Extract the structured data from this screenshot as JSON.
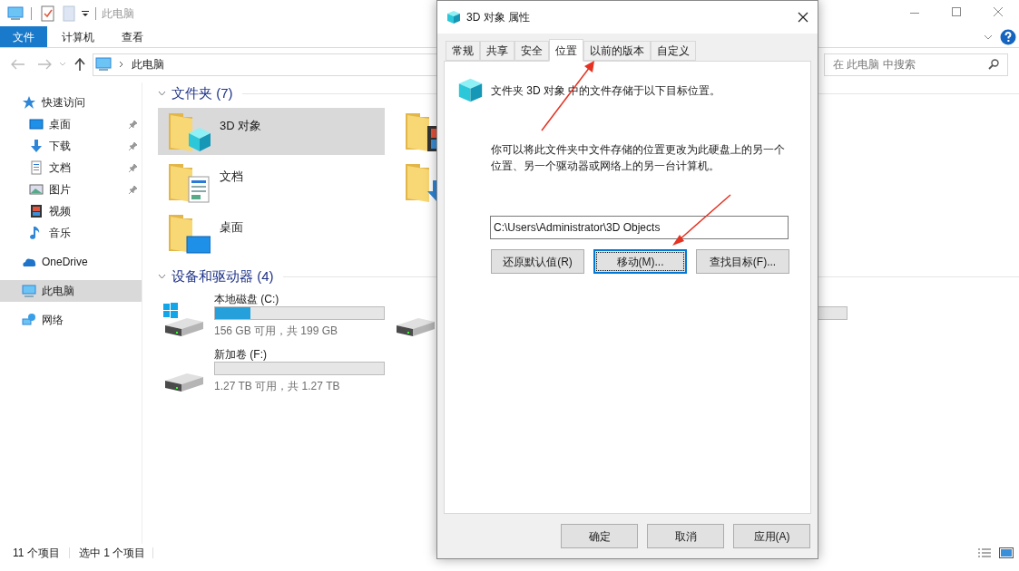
{
  "explorer": {
    "title": "此电脑",
    "ribbon_tabs": [
      {
        "label": "文件",
        "selected": true
      },
      {
        "label": "计算机",
        "selected": false
      },
      {
        "label": "查看",
        "selected": false
      }
    ],
    "address": {
      "path": "此电脑"
    },
    "search": {
      "placeholder": "在 此电脑 中搜索"
    },
    "sidebar": {
      "items": [
        {
          "label": "快速访问",
          "kind": "star",
          "selected": false,
          "children": [
            {
              "label": "桌面",
              "kind": "desktop",
              "pinned": true,
              "selected": false
            },
            {
              "label": "下载",
              "kind": "download",
              "pinned": true,
              "selected": false
            },
            {
              "label": "文档",
              "kind": "document",
              "pinned": true,
              "selected": false
            },
            {
              "label": "图片",
              "kind": "picture",
              "pinned": true,
              "selected": false
            },
            {
              "label": "视频",
              "kind": "video",
              "pinned": false,
              "selected": false
            },
            {
              "label": "音乐",
              "kind": "music",
              "pinned": false,
              "selected": false
            }
          ]
        },
        {
          "label": "OneDrive",
          "kind": "cloud",
          "selected": false
        },
        {
          "label": "此电脑",
          "kind": "computer",
          "selected": true
        },
        {
          "label": "网络",
          "kind": "network",
          "selected": false
        }
      ]
    },
    "folders": {
      "title": "文件夹 (7)",
      "items": [
        {
          "name": "3D 对象",
          "kind": "cube",
          "selected": true
        },
        {
          "kind": "video",
          "selected": false
        },
        {
          "name": "文档",
          "kind": "document",
          "selected": false
        },
        {
          "kind": "downloads",
          "selected": false
        },
        {
          "name": "桌面",
          "kind": "desktop",
          "selected": false
        }
      ]
    },
    "drives": {
      "title": "设备和驱动器 (4)",
      "items": [
        {
          "name": "本地磁盘 (C:)",
          "kind": "system",
          "level": 0.21,
          "reading": "156 GB 可用，共 199 GB"
        },
        {
          "kind": "disk"
        },
        {
          "kind": "none"
        },
        {
          "name": "新加卷 (F:)",
          "kind": "disk",
          "reading": "1.27 TB 可用，共 1.27 TB"
        }
      ]
    },
    "status_bar": {
      "count": "11 个项目",
      "selection": "选中 1 个项目"
    }
  },
  "dialog": {
    "title": "3D 对象 属性",
    "tabs": [
      {
        "label": "常规",
        "selected": false
      },
      {
        "label": "共享",
        "selected": false
      },
      {
        "label": "安全",
        "selected": false
      },
      {
        "label": "位置",
        "selected": true
      },
      {
        "label": "以前的版本",
        "selected": false
      },
      {
        "label": "自定义",
        "selected": false
      }
    ],
    "heading": "文件夹 3D 对象 中的文件存储于以下目标位置。",
    "description": "你可以将此文件夹中文件存储的位置更改为此硬盘上的另一个位置、另一个驱动器或网络上的另一台计算机。",
    "path": "C:\\Users\\Administrator\\3D Objects",
    "actions": [
      {
        "label": "还原默认值(R)",
        "focused": false
      },
      {
        "label": "移动(M)...",
        "focused": true
      },
      {
        "label": "查找目标(F)...",
        "focused": false
      }
    ],
    "buttons": [
      "确定",
      "取消",
      "应用(A)"
    ]
  }
}
